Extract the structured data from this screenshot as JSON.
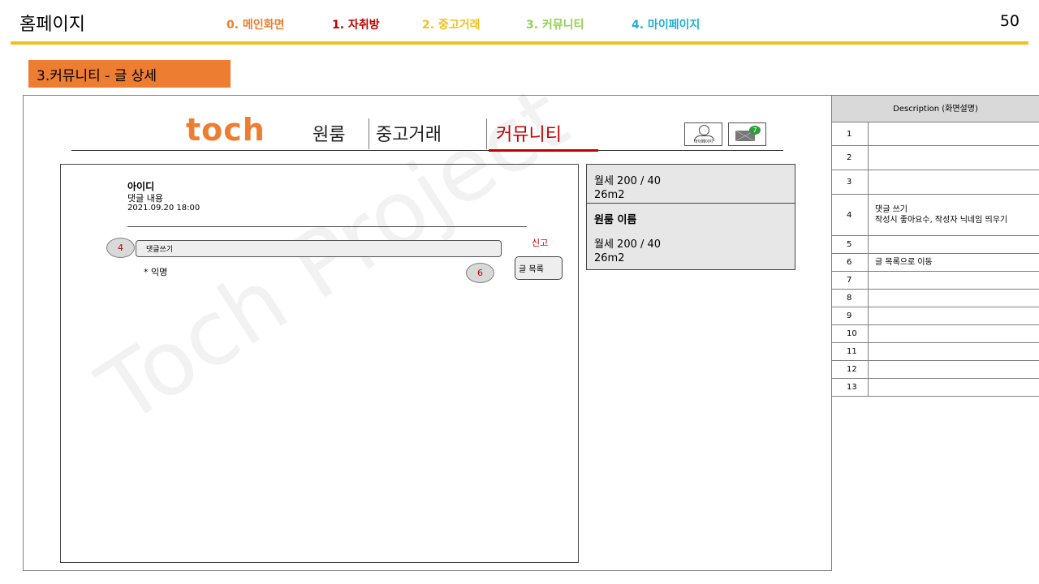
{
  "header": {
    "title": "홈페이지",
    "page_number": "50",
    "nav": [
      {
        "label": "0. 메인화면",
        "color": "#ed7d31"
      },
      {
        "label": "1. 자취방",
        "color": "#c00000"
      },
      {
        "label": "2. 중고거래",
        "color": "#f2c01e"
      },
      {
        "label": "3. 커뮤니티",
        "color": "#92d050"
      },
      {
        "label": "4. 마이페이지",
        "color": "#1fb0d4"
      }
    ]
  },
  "section_tag": "3.커뮤니티 - 글 상세",
  "watermark": "Toch Project",
  "site": {
    "logo": "toch",
    "nav": [
      "원룸",
      "중고거래",
      "커뮤니티"
    ],
    "active_tab": "커뮤니티",
    "mypage_label": "마이페이지",
    "mail_badge": "7"
  },
  "comment": {
    "author": "아이디",
    "text": "댓글 내용",
    "date": "2021.09.20 18:00",
    "input_placeholder": "댓글쓰기",
    "report": "신고",
    "anonymous": "* 익명",
    "list_button": "글 목록"
  },
  "markers": {
    "m4": "4",
    "m6": "6"
  },
  "sidebar": {
    "box1": {
      "line1": "월세 200 / 40",
      "line2": "26m2"
    },
    "box2": {
      "name": "원룸 이름",
      "line1": "월세 200 / 40",
      "line2": "26m2"
    }
  },
  "description": {
    "header": "Description (화면설명)",
    "rows": [
      {
        "num": "1",
        "text": ""
      },
      {
        "num": "2",
        "text": ""
      },
      {
        "num": "3",
        "text": ""
      },
      {
        "num": "4",
        "text": "댓글 쓰기\n작성시 좋아요수, 작성자 닉네임 띄우기"
      },
      {
        "num": "5",
        "text": ""
      },
      {
        "num": "6",
        "text": "글 목록으로 이동"
      },
      {
        "num": "7",
        "text": ""
      },
      {
        "num": "8",
        "text": ""
      },
      {
        "num": "9",
        "text": ""
      },
      {
        "num": "10",
        "text": ""
      },
      {
        "num": "11",
        "text": ""
      },
      {
        "num": "12",
        "text": ""
      },
      {
        "num": "13",
        "text": ""
      }
    ]
  }
}
